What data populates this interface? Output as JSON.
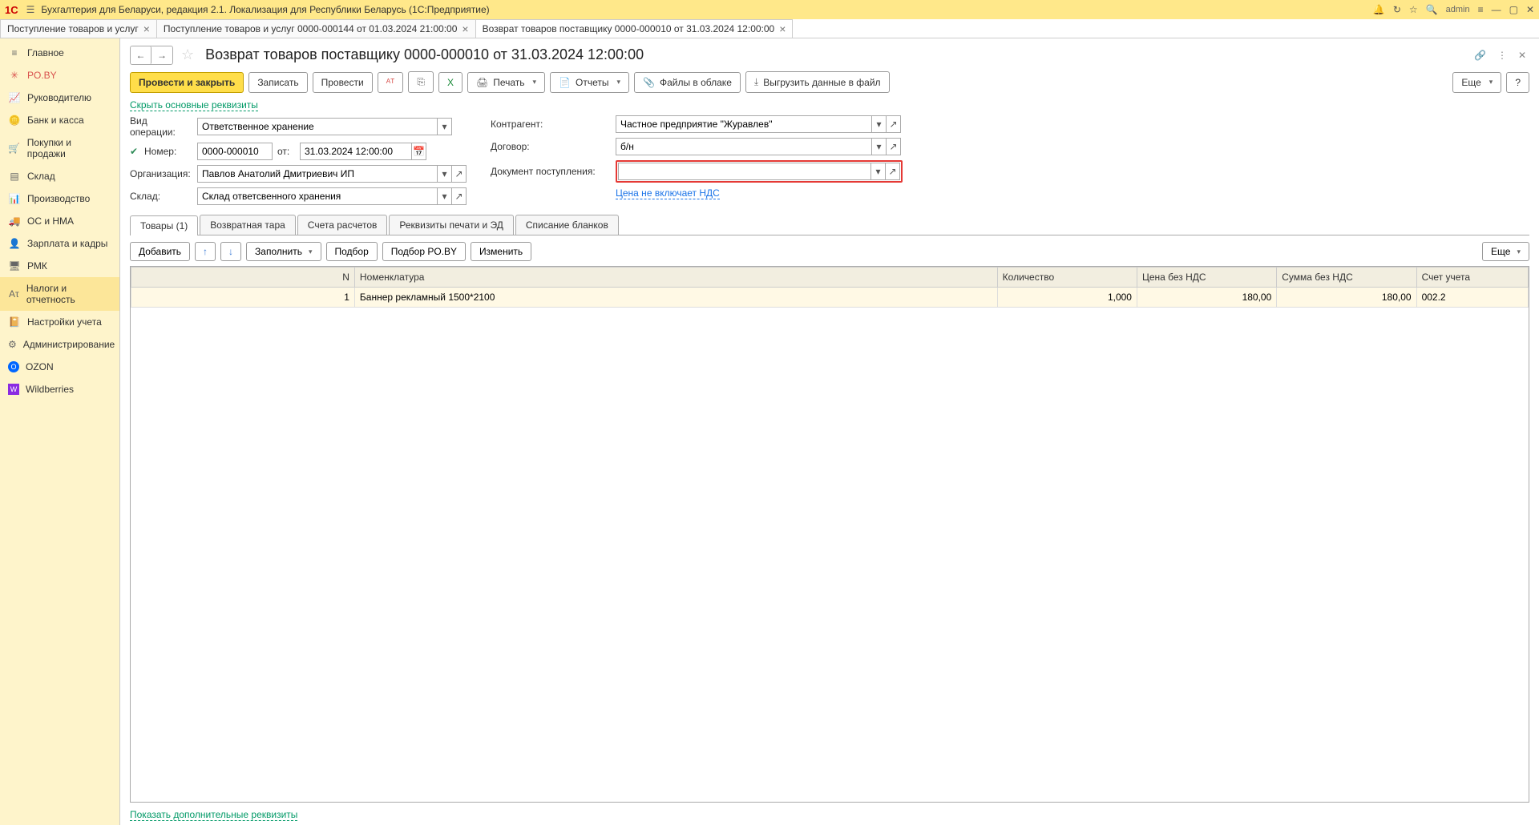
{
  "header": {
    "app_title": "Бухгалтерия для Беларуси, редакция 2.1. Локализация для Республики Беларусь   (1С:Предприятие)",
    "user": "admin",
    "logo": "1C"
  },
  "tabs": [
    {
      "label": "Поступление товаров и услуг"
    },
    {
      "label": "Поступление товаров и услуг 0000-000144 от 01.03.2024 21:00:00"
    },
    {
      "label": "Возврат товаров поставщику 0000-000010 от 31.03.2024 12:00:00",
      "active": true
    }
  ],
  "sidebar": [
    {
      "icon": "≡",
      "label": "Главное"
    },
    {
      "icon": "✳",
      "label": "PO.BY",
      "cls": "poby"
    },
    {
      "icon": "📈",
      "label": "Руководителю"
    },
    {
      "icon": "🪙",
      "label": "Банк и касса"
    },
    {
      "icon": "🛒",
      "label": "Покупки и продажи"
    },
    {
      "icon": "▤",
      "label": "Склад"
    },
    {
      "icon": "📊",
      "label": "Производство"
    },
    {
      "icon": "🚚",
      "label": "ОС и НМА"
    },
    {
      "icon": "👤",
      "label": "Зарплата и кадры"
    },
    {
      "icon": "🖥",
      "label": "РМК"
    },
    {
      "icon": "Аτ",
      "label": "Налоги и отчетность",
      "active": true
    },
    {
      "icon": "📔",
      "label": "Настройки учета"
    },
    {
      "icon": "⚙",
      "label": "Администрирование"
    },
    {
      "icon": "O",
      "label": "OZON",
      "cls": "ozon"
    },
    {
      "icon": "W",
      "label": "Wildberries",
      "cls": "wb"
    }
  ],
  "page": {
    "title": "Возврат товаров поставщику 0000-000010 от 31.03.2024 12:00:00",
    "more_btn": "Еще",
    "help_btn": "?"
  },
  "toolbar": {
    "post_close": "Провести и закрыть",
    "save": "Записать",
    "post": "Провести",
    "print": "Печать",
    "reports": "Отчеты",
    "cloud_files": "Файлы в облаке",
    "export": "Выгрузить данные в файл"
  },
  "links": {
    "hide_main": "Скрыть основные реквизиты",
    "vat_note": "Цена не включает НДС",
    "show_more": "Показать дополнительные реквизиты"
  },
  "form": {
    "op_type_label": "Вид операции:",
    "op_type_value": "Ответственное хранение",
    "number_label": "Номер:",
    "number_value": "0000-000010",
    "from_label": "от:",
    "date_value": "31.03.2024 12:00:00",
    "org_label": "Организация:",
    "org_value": "Павлов Анатолий Дмитриевич ИП",
    "warehouse_label": "Склад:",
    "warehouse_value": "Склад ответсвенного хранения",
    "partner_label": "Контрагент:",
    "partner_value": "Частное предприятие \"Журавлев\"",
    "contract_label": "Договор:",
    "contract_value": "б/н",
    "receipt_label": "Документ поступления:",
    "receipt_value": ""
  },
  "inner_tabs": [
    "Товары (1)",
    "Возвратная тара",
    "Счета расчетов",
    "Реквизиты печати и ЭД",
    "Списание бланков"
  ],
  "tbl_toolbar": {
    "add": "Добавить",
    "fill": "Заполнить",
    "pick": "Подбор",
    "pick_poby": "Подбор PO.BY",
    "edit": "Изменить",
    "more": "Еще"
  },
  "table": {
    "headers": [
      "N",
      "Номенклатура",
      "Количество",
      "Цена без НДС",
      "Сумма без НДС",
      "Счет учета"
    ],
    "rows": [
      {
        "n": "1",
        "name": "Баннер рекламный 1500*2100",
        "qty": "1,000",
        "price": "180,00",
        "sum": "180,00",
        "account": "002.2"
      }
    ]
  }
}
